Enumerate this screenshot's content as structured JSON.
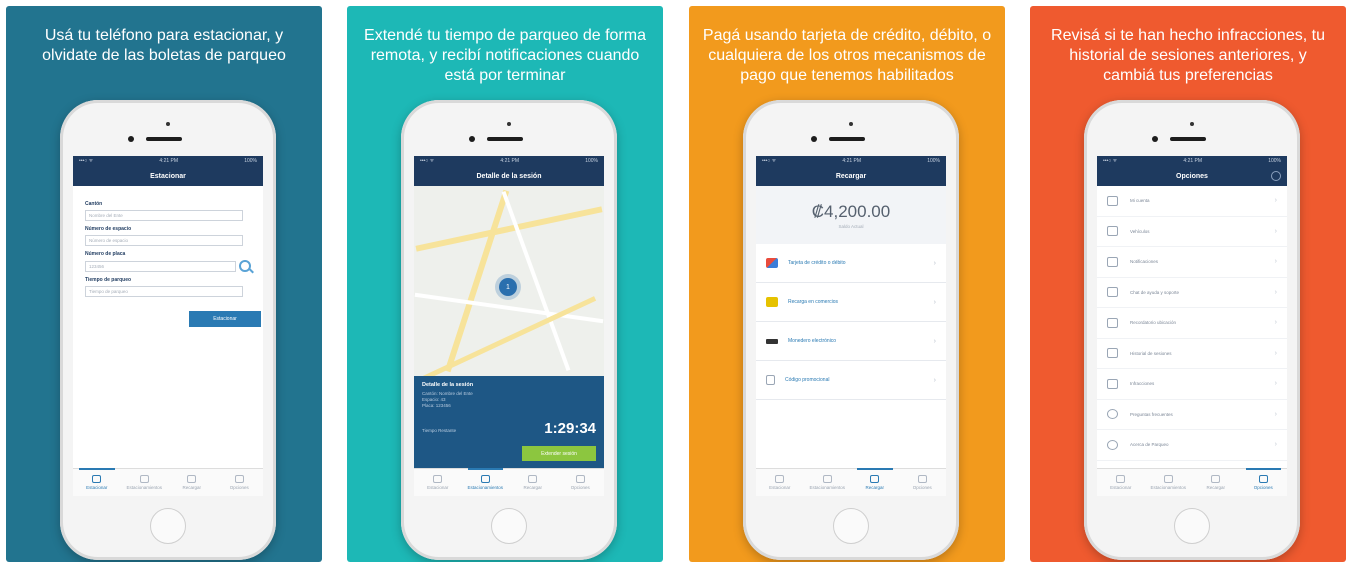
{
  "panels": [
    {
      "bg": "#22748f",
      "caption": "Usá tu teléfono para estacionar, y olvidate de las boletas de parqueo",
      "screen": {
        "status_left": "•••○ ᯤ",
        "status_time": "4:21 PM",
        "status_right": "100%",
        "title": "Estacionar",
        "fields": [
          {
            "label": "Cantón",
            "placeholder": "Nombre del Ente"
          },
          {
            "label": "Número de espacio",
            "placeholder": "Número de espacio"
          },
          {
            "label": "Número de placa",
            "placeholder": "123456"
          },
          {
            "label": "Tiempo de parqueo",
            "placeholder": "Tiempo de parqueo"
          }
        ],
        "action": "Estacionar",
        "tabs": [
          "Estacionar",
          "Estacionamientos",
          "Recargar",
          "Opciones"
        ]
      }
    },
    {
      "bg": "#1db8b6",
      "caption": "Extendé tu tiempo de parqueo de forma remota, y recibí notificaciones cuando está por terminar",
      "screen": {
        "status_left": "•••○ ᯤ",
        "status_time": "4:21 PM",
        "status_right": "100%",
        "title": "Detalle de la sesión",
        "pin": "1",
        "details_title": "Detalle de la sesión",
        "details_lines": [
          "Cantón: Nombre del Ente",
          "Espacio: 43",
          "Placa: 123456"
        ],
        "remaining_label": "Tiempo Restante",
        "timer": "1:29:34",
        "extend_label": "Extender sesión",
        "tabs": [
          "Estacionar",
          "Estacionamientos",
          "Recargar",
          "Opciones"
        ]
      }
    },
    {
      "bg": "#f29a1d",
      "caption": "Pagá usando tarjeta de crédito, débito, o cualquiera de los otros mecanismos de pago que tenemos habilitados",
      "screen": {
        "status_left": "•••○ ᯤ",
        "status_time": "4:21 PM",
        "status_right": "100%",
        "title": "Recargar",
        "balance": "₡4,200.00",
        "balance_label": "Saldo Actual",
        "methods": [
          "Tarjeta de crédito o débito",
          "Recarga en comercios",
          "Monedero electrónico",
          "Código promocional"
        ],
        "tabs": [
          "Estacionar",
          "Estacionamientos",
          "Recargar",
          "Opciones"
        ]
      }
    },
    {
      "bg": "#ef5a2f",
      "caption": "Revisá si te han hecho infracciones, tu historial de sesiones anteriores, y cambiá tus preferencias",
      "screen": {
        "status_left": "•••○ ᯤ",
        "status_time": "4:21 PM",
        "status_right": "100%",
        "title": "Opciones",
        "items": [
          "Mi cuenta",
          "Vehículos",
          "Notificaciones",
          "Chat de ayuda y soporte",
          "Recordatorio ubicación",
          "Historial de sesiones",
          "Infracciones",
          "Preguntas frecuentes",
          "Acerca de Parqueo"
        ],
        "tabs": [
          "Estacionar",
          "Estacionamientos",
          "Recargar",
          "Opciones"
        ]
      }
    }
  ]
}
